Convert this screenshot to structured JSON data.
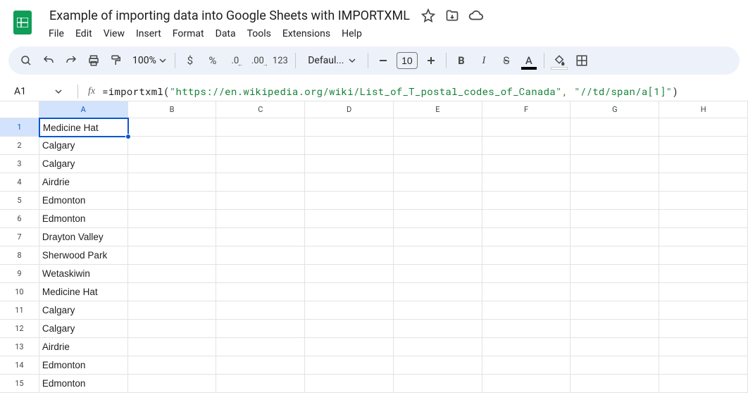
{
  "doc": {
    "title": "Example of importing data into Google Sheets with IMPORTXML"
  },
  "menu": {
    "items": [
      "File",
      "Edit",
      "View",
      "Insert",
      "Format",
      "Data",
      "Tools",
      "Extensions",
      "Help"
    ]
  },
  "toolbar": {
    "zoom": "100%",
    "font": "Defaul...",
    "size": "10"
  },
  "formula": {
    "cellRef": "A1",
    "fn": "=importxml",
    "open": "(",
    "arg1": "\"https://en.wikipedia.org/wiki/List_of_T_postal_codes_of_Canada\"",
    "comma": ", ",
    "arg2": "\"//td/span/a[1]\"",
    "close": ")"
  },
  "columns": [
    "A",
    "B",
    "C",
    "D",
    "E",
    "F",
    "G",
    "H"
  ],
  "rows": [
    {
      "n": "1",
      "a": "Medicine Hat"
    },
    {
      "n": "2",
      "a": "Calgary"
    },
    {
      "n": "3",
      "a": "Calgary"
    },
    {
      "n": "4",
      "a": "Airdrie"
    },
    {
      "n": "5",
      "a": "Edmonton"
    },
    {
      "n": "6",
      "a": "Edmonton"
    },
    {
      "n": "7",
      "a": "Drayton Valley"
    },
    {
      "n": "8",
      "a": "Sherwood Park"
    },
    {
      "n": "9",
      "a": "Wetaskiwin"
    },
    {
      "n": "10",
      "a": "Medicine Hat"
    },
    {
      "n": "11",
      "a": "Calgary"
    },
    {
      "n": "12",
      "a": "Calgary"
    },
    {
      "n": "13",
      "a": "Airdrie"
    },
    {
      "n": "14",
      "a": "Edmonton"
    },
    {
      "n": "15",
      "a": "Edmonton"
    }
  ]
}
